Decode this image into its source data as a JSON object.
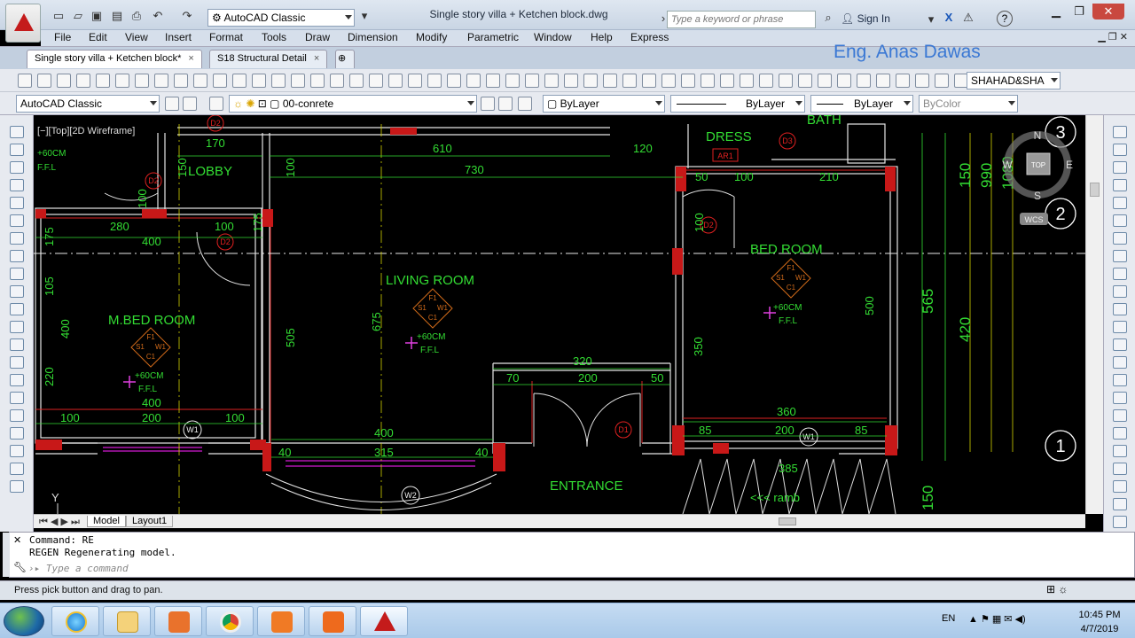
{
  "window": {
    "title": "Single story villa + Ketchen block.dwg",
    "workspace": "AutoCAD Classic",
    "search_placeholder": "Type a keyword or phrase",
    "sign_in": "Sign In",
    "help": "?"
  },
  "menu": [
    "File",
    "Edit",
    "View",
    "Insert",
    "Format",
    "Tools",
    "Draw",
    "Dimension",
    "Modify",
    "Parametric",
    "Window",
    "Help",
    "Express"
  ],
  "tabs": [
    {
      "label": "Single story villa + Ketchen block*",
      "active": true
    },
    {
      "label": "S18 Structural Detail",
      "active": false
    }
  ],
  "watermark": "Eng. Anas Dawas",
  "toolbar2": {
    "workspace": "AutoCAD Classic",
    "layer": "00-conrete",
    "color": "ByLayer",
    "linetype": "ByLayer",
    "lineweight": "ByLayer",
    "plotstyle": "ByColor"
  },
  "textstyle": "SHAHAD&SHA",
  "viewport_label": "[−][Top][2D Wireframe]",
  "viewcube": {
    "n": "N",
    "s": "S",
    "e": "E",
    "w": "W",
    "top": "TOP",
    "wcs": "WCS"
  },
  "axis_y": "Y",
  "drawing": {
    "rooms": [
      {
        "label": "LOBBY",
        "color": "#33dd33"
      },
      {
        "label": "LIVING ROOM",
        "color": "#33dd33"
      },
      {
        "label": "M.BED ROOM",
        "color": "#33dd33"
      },
      {
        "label": "BED ROOM",
        "color": "#33dd33"
      },
      {
        "label": "DRESS",
        "color": "#33dd33"
      },
      {
        "label": "BATH",
        "color": "#33dd33"
      },
      {
        "label": "ENTRANCE",
        "color": "#33dd33"
      },
      {
        "label": "<<< ramb",
        "color": "#33dd33"
      }
    ],
    "level_tag": {
      "level": "+60CM",
      "ref": "F.F.L"
    },
    "finish_tag": [
      "F1",
      "S1",
      "W1",
      "C1"
    ],
    "doors": [
      "D2",
      "D2",
      "D2",
      "D3",
      "D2",
      "D1"
    ],
    "windows": [
      "W1",
      "W1",
      "W2"
    ],
    "ar_tag": "AR1",
    "grid_bubbles": [
      "3",
      "2",
      "1"
    ],
    "dims_top": [
      "170",
      "610",
      "730",
      "120",
      "100",
      "210",
      "50"
    ],
    "dims_left": [
      "100",
      "150",
      "280",
      "400",
      "100",
      "100",
      "175",
      "105",
      "400",
      "220",
      "400",
      "100",
      "200",
      "100"
    ],
    "dims_center": [
      "675",
      "505",
      "400",
      "315",
      "40",
      "40",
      "320",
      "70",
      "200",
      "50"
    ],
    "dims_right": [
      "350",
      "500",
      "360",
      "85",
      "200",
      "85",
      "385",
      "565",
      "420",
      "150",
      "990",
      "1080",
      "150",
      "100"
    ]
  },
  "layout_tabs": [
    "Model",
    "Layout1"
  ],
  "command": {
    "line1": "Command: RE",
    "line2": "REGEN Regenerating model.",
    "prompt": "Type a command"
  },
  "status_text": "Press pick button and drag to pan.",
  "taskbar": {
    "lang": "EN",
    "time": "10:45 PM",
    "date": "4/7/2019"
  },
  "colors": {
    "dim": "#33dd33",
    "tag": "#ff2b2b",
    "wall": "#e0e0e0",
    "bg": "#000000",
    "column": "#d32020"
  }
}
